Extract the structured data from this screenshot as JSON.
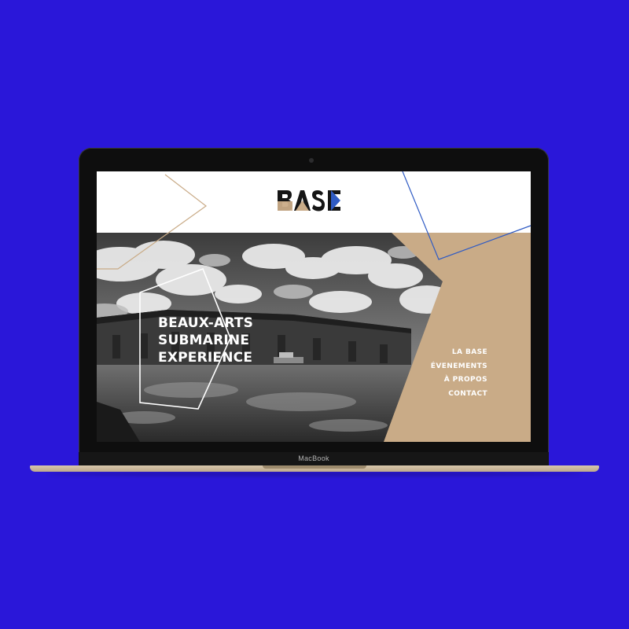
{
  "device": {
    "brand_label": "MacBook"
  },
  "site": {
    "logo_text": "BASE",
    "hero_title_lines": [
      "BEAUX-ARTS",
      "SUBMARINE",
      "EXPERIENCE"
    ],
    "nav": [
      "LA BASE",
      "ÉVENEMENTS",
      "À PROPOS",
      "CONTACT"
    ]
  },
  "colors": {
    "background": "#2a17d9",
    "accent_tan": "#c9ab87",
    "accent_blue": "#2f5bc4",
    "logo_dark": "#151515"
  },
  "icons": [
    "camera-dot",
    "outline-hexagon",
    "logo-mark"
  ]
}
